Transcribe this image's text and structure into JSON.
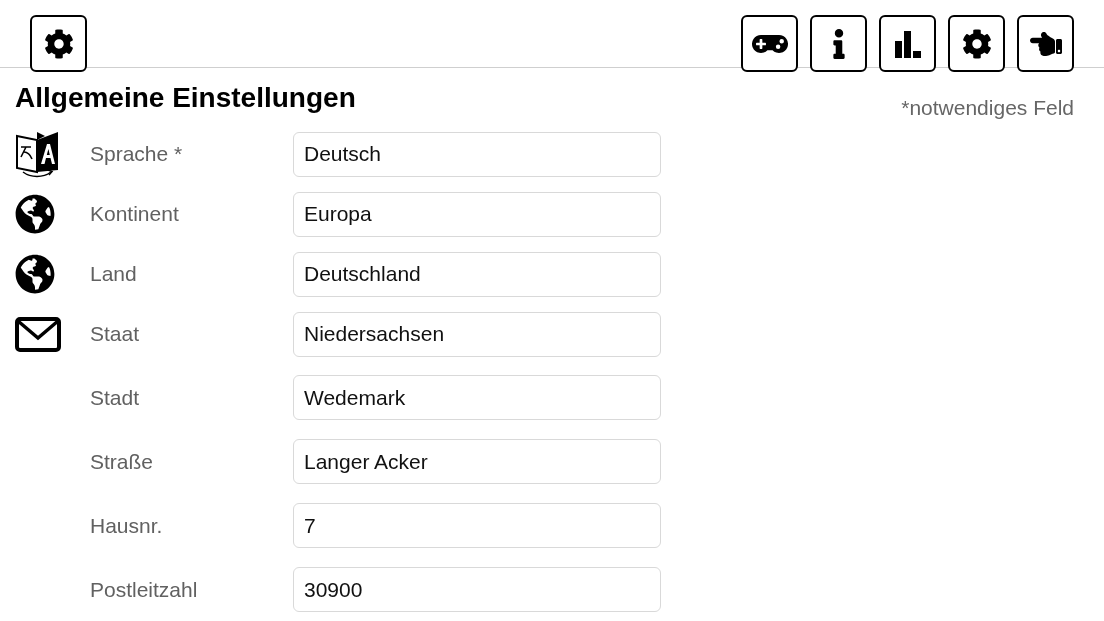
{
  "header": {
    "title": "Allgemeine Einstellungen",
    "required_note": "*notwendiges Feld"
  },
  "fields": [
    {
      "label": "Sprache *",
      "value": "Deutsch"
    },
    {
      "label": "Kontinent",
      "value": "Europa"
    },
    {
      "label": "Land",
      "value": "Deutschland"
    },
    {
      "label": "Staat",
      "value": "Niedersachsen"
    },
    {
      "label": "Stadt",
      "value": "Wedemark"
    },
    {
      "label": "Straße",
      "value": "Langer Acker"
    },
    {
      "label": "Hausnr.",
      "value": "7"
    },
    {
      "label": "Postleitzahl",
      "value": "30900"
    }
  ]
}
